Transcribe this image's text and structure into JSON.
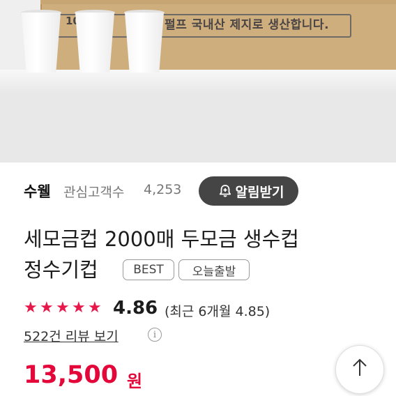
{
  "product_image": {
    "box_text_left": "10",
    "box_text_right": "펄프 국내산 제지로 생산합니다."
  },
  "seller": {
    "name": "수웰",
    "followers_label": "관심고객수",
    "followers_count": "4,253",
    "alert_button_label": "알림받기"
  },
  "product": {
    "title_line1": "세모금컵 2000매 두모금 생수컵",
    "title_line2": "정수기컵",
    "tags": [
      "BEST",
      "오늘출발"
    ]
  },
  "rating": {
    "stars": 5,
    "value": "4.86",
    "recent_text": "(최근 6개월 4.85)",
    "review_link": "522건 리뷰 보기"
  },
  "price": {
    "amount": "13,500",
    "unit": "원"
  },
  "colors": {
    "accent": "#e3073a",
    "button_dark": "#454545"
  },
  "icons": {
    "bell": "bell-plus-icon",
    "info": "info-icon",
    "scroll_top": "arrow-up-icon",
    "star": "star-icon"
  }
}
